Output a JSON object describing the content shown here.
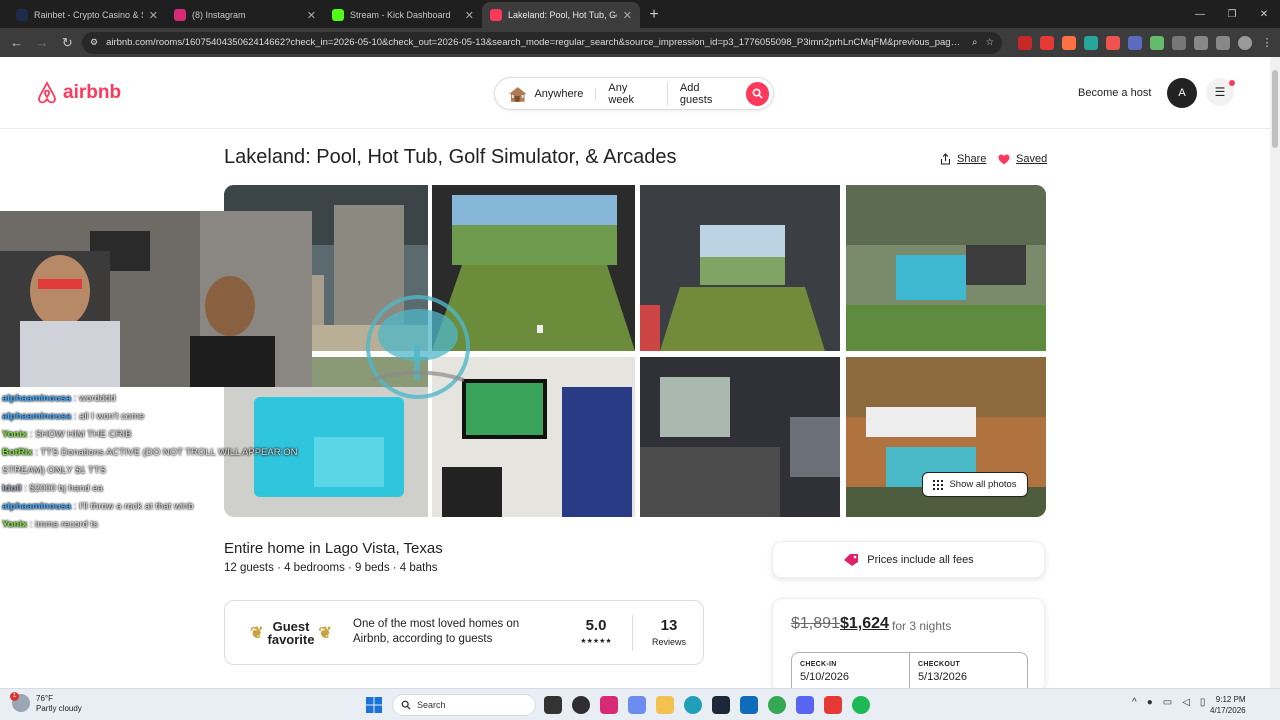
{
  "browser": {
    "tabs": [
      {
        "title": "Rainbet - Crypto Casino & Spo",
        "color": "#1d2b4a",
        "active": false
      },
      {
        "title": "(8) Instagram",
        "color": "#d62976",
        "active": false
      },
      {
        "title": "Stream - Kick Dashboard",
        "color": "#53fc18",
        "active": false
      },
      {
        "title": "Lakeland: Pool, Hot Tub, Golf Si",
        "color": "#ff385c",
        "active": true
      }
    ],
    "url": "airbnb.com/rooms/1607540435062414662?check_in=2026-05-10&check_out=2026-05-13&search_mode=regular_search&source_impression_id=p3_1776055098_P3imn2prhLnCMqFM&previous_page_sect..."
  },
  "header": {
    "logo_text": "airbnb",
    "search": {
      "where": "Anywhere",
      "when": "Any week",
      "who": "Add guests"
    },
    "become_host": "Become a host",
    "avatar_initial": "A"
  },
  "listing": {
    "title": "Lakeland: Pool, Hot Tub, Golf Simulator, & Arcades",
    "share_label": "Share",
    "saved_label": "Saved",
    "show_all_photos": "Show all photos",
    "subtitle": "Entire home in Lago Vista, Texas",
    "details": "12 guests · 4 bedrooms · 9 beds · 4 baths",
    "guest_favorite": {
      "badge_line1": "Guest",
      "badge_line2": "favorite",
      "description": "One of the most loved homes on Airbnb, according to guests",
      "rating": "5.0",
      "stars": "★★★★★",
      "reviews_count": "13",
      "reviews_label": "Reviews"
    }
  },
  "booking": {
    "fees_note": "Prices include all fees",
    "old_price": "$1,891",
    "new_price": "$1,624",
    "nights": "for 3 nights",
    "checkin_label": "CHECK-IN",
    "checkin_value": "5/10/2026",
    "checkout_label": "CHECKOUT",
    "checkout_value": "5/13/2026"
  },
  "stream_overlay": {
    "chat": [
      {
        "user": "alphaaminousa",
        "msg": " : wordddd",
        "cls": "u1"
      },
      {
        "user": "alphaaminousa",
        "msg": " : all I won't come",
        "cls": "u1"
      },
      {
        "user": "Yonix",
        "msg": " : SHOW HIM THE CRIB",
        "cls": "u2"
      },
      {
        "user": "BotRix",
        "msg": " : TTS Donations ACTIVE (DO NOT TROLL WILL APPEAR ON STREAM) ONLY $1 TTS",
        "cls": "u2"
      },
      {
        "user": "Idoll",
        "msg": " : $2000 bj hand ea",
        "cls": "u3"
      },
      {
        "user": "alphaaminousa",
        "msg": " : I'll throw a rock at that winb",
        "cls": "u1"
      },
      {
        "user": "Yonix",
        "msg": " : imma record ts",
        "cls": "u2"
      }
    ]
  },
  "taskbar": {
    "temp": "76°F",
    "weather": "Partly cloudy",
    "weather_badge": "1",
    "search_label": "Search",
    "time": "9:12 PM",
    "date": "4/17/2026"
  }
}
